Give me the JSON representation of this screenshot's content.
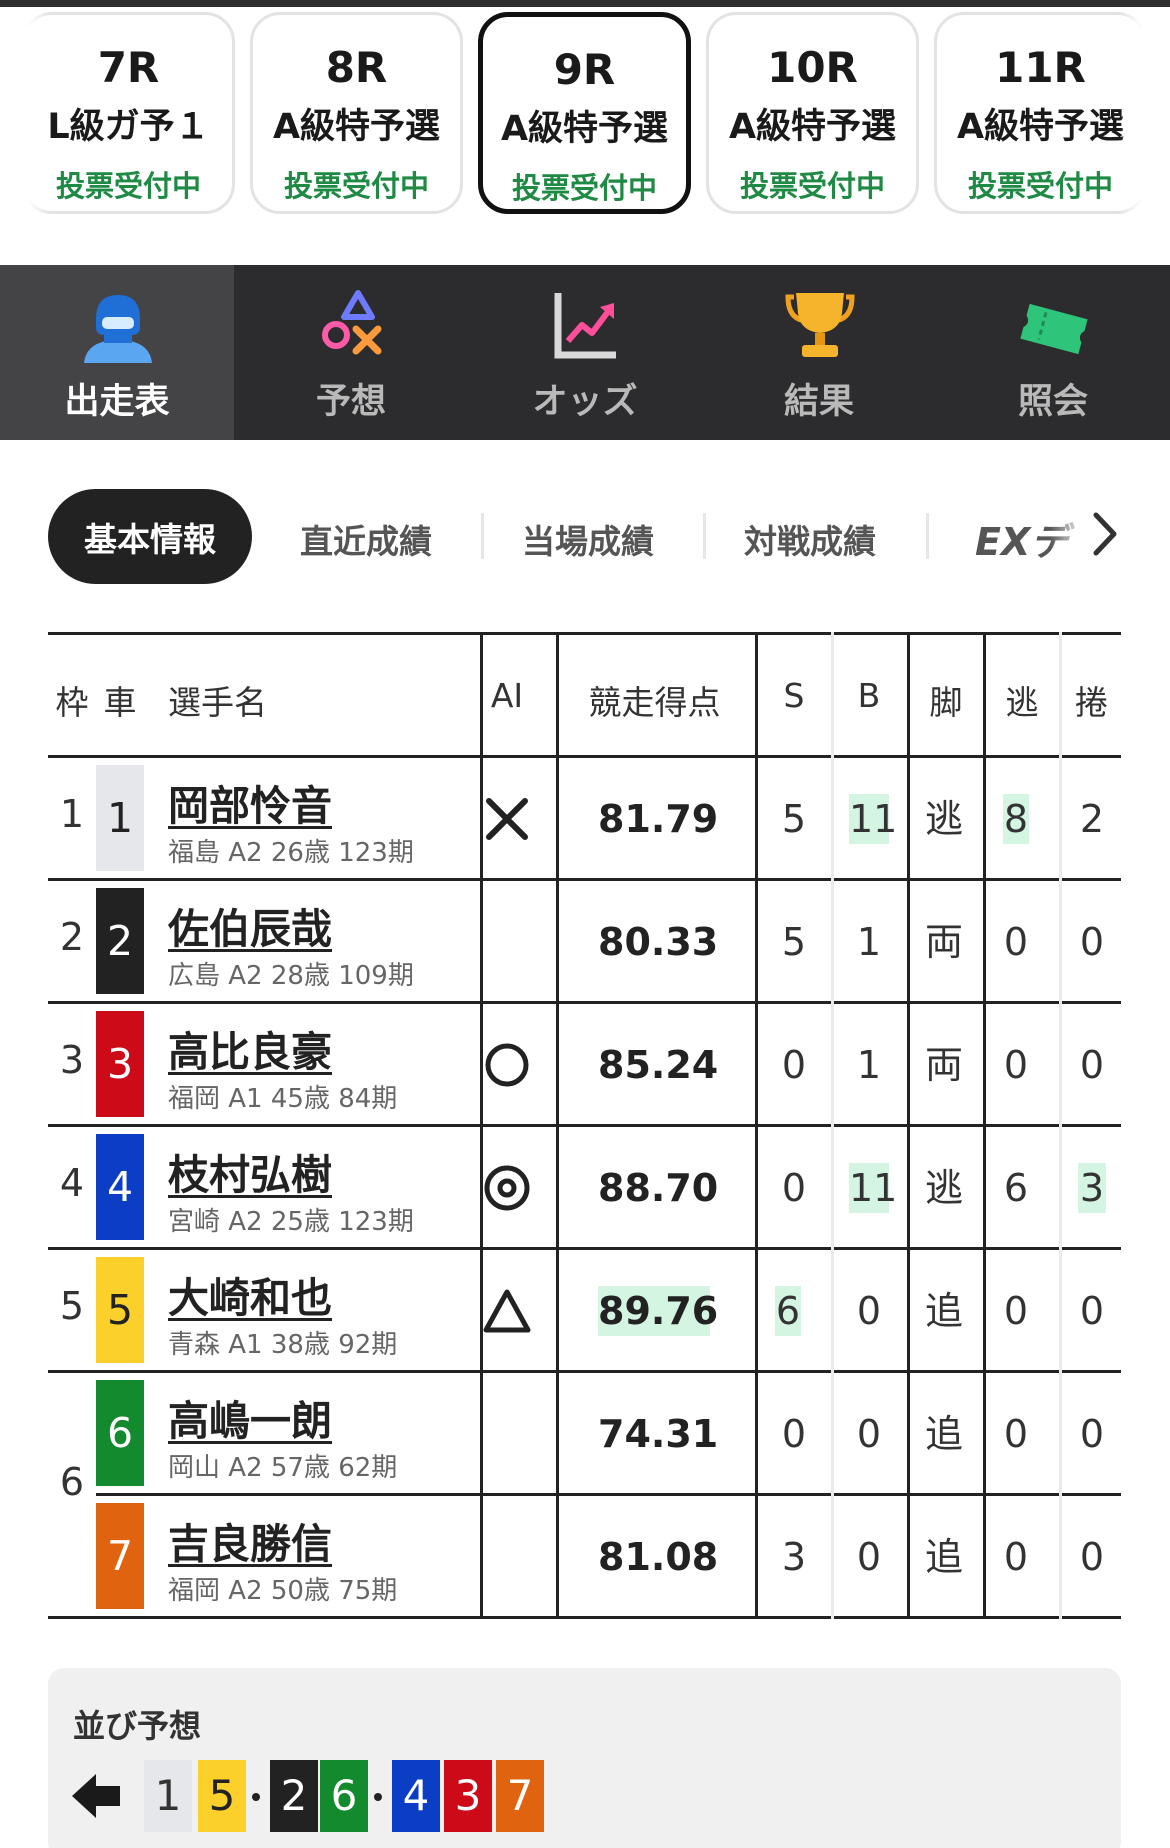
{
  "races": [
    {
      "number": "7R",
      "grade": "L級ガ予１",
      "status": "投票受付中",
      "active": false
    },
    {
      "number": "8R",
      "grade": "A級特予選",
      "status": "投票受付中",
      "active": false
    },
    {
      "number": "9R",
      "grade": "A級特予選",
      "status": "投票受付中",
      "active": true
    },
    {
      "number": "10R",
      "grade": "A級特予選",
      "status": "投票受付中",
      "active": false
    },
    {
      "number": "11R",
      "grade": "A級特予選",
      "status": "投票受付中",
      "active": false
    }
  ],
  "nav": [
    {
      "label": "出走表",
      "icon": "racer-helmet-icon",
      "active": true
    },
    {
      "label": "予想",
      "icon": "prediction-marks-icon",
      "active": false
    },
    {
      "label": "オッズ",
      "icon": "odds-chart-icon",
      "active": false
    },
    {
      "label": "結果",
      "icon": "trophy-icon",
      "active": false
    },
    {
      "label": "照会",
      "icon": "ticket-icon",
      "active": false
    }
  ],
  "info_tabs": [
    "基本情報",
    "直近成績",
    "当場成績",
    "対戦成績",
    "EXデ"
  ],
  "table": {
    "headers": {
      "waku": "枠",
      "car": "車",
      "name": "選手名",
      "ai": "AI",
      "score": "競走得点",
      "s": "S",
      "b": "B",
      "kyaku": "脚",
      "nige": "逃",
      "makuri": "捲"
    },
    "rows": [
      {
        "waku": "1",
        "car": "1",
        "name": "岡部怜音",
        "info": "福島 A2 26歳 123期",
        "ai": "×",
        "score": "81.79",
        "s": "5",
        "b": "11",
        "kyaku": "逃",
        "nige": "8",
        "makuri": "2"
      },
      {
        "waku": "2",
        "car": "2",
        "name": "佐伯辰哉",
        "info": "広島 A2 28歳 109期",
        "ai": "",
        "score": "80.33",
        "s": "5",
        "b": "1",
        "kyaku": "両",
        "nige": "0",
        "makuri": "0"
      },
      {
        "waku": "3",
        "car": "3",
        "name": "高比良豪",
        "info": "福岡 A1 45歳 84期",
        "ai": "○",
        "score": "85.24",
        "s": "0",
        "b": "1",
        "kyaku": "両",
        "nige": "0",
        "makuri": "0"
      },
      {
        "waku": "4",
        "car": "4",
        "name": "枝村弘樹",
        "info": "宮崎 A2 25歳 123期",
        "ai": "◎",
        "score": "88.70",
        "s": "0",
        "b": "11",
        "kyaku": "逃",
        "nige": "6",
        "makuri": "3"
      },
      {
        "waku": "5",
        "car": "5",
        "name": "大崎和也",
        "info": "青森 A1 38歳 92期",
        "ai": "△",
        "score": "89.76",
        "s": "6",
        "b": "0",
        "kyaku": "追",
        "nige": "0",
        "makuri": "0"
      },
      {
        "waku": "",
        "car": "6",
        "name": "高嶋一朗",
        "info": "岡山 A2 57歳 62期",
        "ai": "",
        "score": "74.31",
        "s": "0",
        "b": "0",
        "kyaku": "追",
        "nige": "0",
        "makuri": "0"
      },
      {
        "waku": "",
        "car": "7",
        "name": "吉良勝信",
        "info": "福岡 A2 50歳 75期",
        "ai": "",
        "score": "81.08",
        "s": "3",
        "b": "0",
        "kyaku": "追",
        "nige": "0",
        "makuri": "0"
      }
    ],
    "shared_waku": {
      "label": "6",
      "rows": [
        6,
        7
      ]
    }
  },
  "lineup": {
    "title": "並び予想",
    "groups": [
      [
        "1"
      ],
      [
        "5"
      ],
      [
        "2",
        "6"
      ],
      [
        "4",
        "3",
        "7"
      ]
    ]
  },
  "colors": {
    "car_1": "#e5e7ea",
    "car_2": "#222222",
    "car_3": "#cc0a18",
    "car_4": "#0b3ec4",
    "car_5": "#fcd02a",
    "car_6": "#138a2e",
    "car_7": "#e06410",
    "status_green": "#1f8a44",
    "highlight": "#d4f5e1",
    "nav_bg": "#2c2c2e"
  }
}
